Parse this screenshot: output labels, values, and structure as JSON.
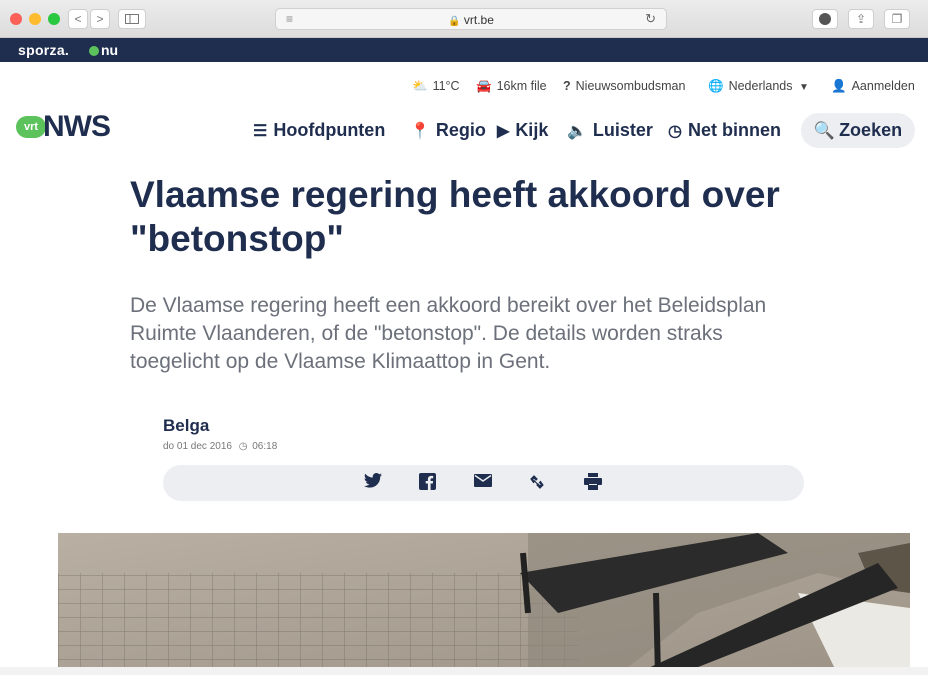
{
  "browser": {
    "url": "vrt.be",
    "nav_back": "<",
    "nav_forward": ">"
  },
  "brandbar": {
    "sporza": "sporza.",
    "nu": "nu"
  },
  "utility": {
    "weather": "11°C",
    "traffic": "16km file",
    "ombudsman": "Nieuwsombudsman",
    "language": "Nederlands",
    "login": "Aanmelden"
  },
  "logo": {
    "badge": "vrt",
    "name": "NWS"
  },
  "nav": {
    "items": [
      {
        "label": "Hoofdpunten",
        "icon": "list-icon"
      },
      {
        "label": "Regio",
        "icon": "location-pin-icon"
      },
      {
        "label": "Kijk",
        "icon": "play-icon"
      },
      {
        "label": "Luister",
        "icon": "speaker-icon"
      },
      {
        "label": "Net binnen",
        "icon": "clock-icon"
      }
    ],
    "search": "Zoeken"
  },
  "article": {
    "title": "Vlaamse regering heeft akkoord over \"betonstop\"",
    "lead": "De Vlaamse regering heeft een akkoord bereikt over het Beleidsplan Ruimte Vlaanderen, of de \"betonstop\". De details worden straks toegelicht op de Vlaamse Klimaattop in Gent.",
    "author": "Belga",
    "date": "do 01 dec 2016",
    "time": "06:18"
  },
  "share": {
    "icons": [
      "twitter-icon",
      "facebook-icon",
      "mail-icon",
      "link-icon",
      "print-icon"
    ]
  },
  "colors": {
    "brand_navy": "#1f2d4e",
    "vrt_green": "#5cc35c"
  }
}
